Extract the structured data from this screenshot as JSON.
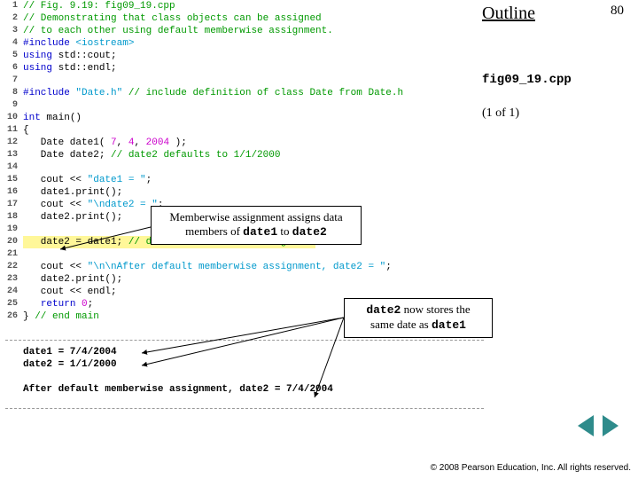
{
  "page_number": "80",
  "outline": "Outline",
  "filename": "fig09_19.cpp",
  "progress": "(1 of 1)",
  "lines": [
    {
      "n": "1",
      "seg": [
        {
          "t": "// Fig. 9.19: fig09_19.cpp",
          "c": "c-comment"
        }
      ]
    },
    {
      "n": "2",
      "seg": [
        {
          "t": "// Demonstrating that class objects can be assigned",
          "c": "c-comment"
        }
      ]
    },
    {
      "n": "3",
      "seg": [
        {
          "t": "// to each other using default memberwise assignment.",
          "c": "c-comment"
        }
      ]
    },
    {
      "n": "4",
      "seg": [
        {
          "t": "#include ",
          "c": "c-pre"
        },
        {
          "t": "<iostream>",
          "c": "c-str"
        }
      ]
    },
    {
      "n": "5",
      "seg": [
        {
          "t": "using",
          "c": "c-key"
        },
        {
          "t": " std::cout;",
          "c": ""
        }
      ]
    },
    {
      "n": "6",
      "seg": [
        {
          "t": "using",
          "c": "c-key"
        },
        {
          "t": " std::endl;",
          "c": ""
        }
      ]
    },
    {
      "n": "7",
      "seg": []
    },
    {
      "n": "8",
      "seg": [
        {
          "t": "#include ",
          "c": "c-pre"
        },
        {
          "t": "\"Date.h\"",
          "c": "c-str"
        },
        {
          "t": " // include definition of class Date from Date.h",
          "c": "c-comment"
        }
      ]
    },
    {
      "n": "9",
      "seg": []
    },
    {
      "n": "10",
      "seg": [
        {
          "t": "int",
          "c": "c-key"
        },
        {
          "t": " main()",
          "c": ""
        }
      ]
    },
    {
      "n": "11",
      "seg": [
        {
          "t": "{",
          "c": ""
        }
      ]
    },
    {
      "n": "12",
      "seg": [
        {
          "t": "   Date date1( ",
          "c": ""
        },
        {
          "t": "7",
          "c": "c-num"
        },
        {
          "t": ", ",
          "c": ""
        },
        {
          "t": "4",
          "c": "c-num"
        },
        {
          "t": ", ",
          "c": ""
        },
        {
          "t": "2004",
          "c": "c-num"
        },
        {
          "t": " );",
          "c": ""
        }
      ]
    },
    {
      "n": "13",
      "seg": [
        {
          "t": "   Date date2; ",
          "c": ""
        },
        {
          "t": "// date2 defaults to 1/1/2000",
          "c": "c-comment"
        }
      ]
    },
    {
      "n": "14",
      "seg": []
    },
    {
      "n": "15",
      "seg": [
        {
          "t": "   cout << ",
          "c": ""
        },
        {
          "t": "\"date1 = \"",
          "c": "c-str"
        },
        {
          "t": ";",
          "c": ""
        }
      ]
    },
    {
      "n": "16",
      "seg": [
        {
          "t": "   date1.print();",
          "c": ""
        }
      ]
    },
    {
      "n": "17",
      "seg": [
        {
          "t": "   cout << ",
          "c": ""
        },
        {
          "t": "\"\\ndate2 = \"",
          "c": "c-str"
        },
        {
          "t": ";",
          "c": ""
        }
      ]
    },
    {
      "n": "18",
      "seg": [
        {
          "t": "   date2.print();",
          "c": ""
        }
      ]
    },
    {
      "n": "19",
      "seg": []
    },
    {
      "n": "20",
      "hl": true,
      "seg": [
        {
          "t": "   date2 = date1; ",
          "c": ""
        },
        {
          "t": "// default memberwise assignment",
          "c": "c-comment"
        }
      ]
    },
    {
      "n": "21",
      "seg": []
    },
    {
      "n": "22",
      "seg": [
        {
          "t": "   cout << ",
          "c": ""
        },
        {
          "t": "\"\\n\\nAfter default memberwise assignment, date2 = \"",
          "c": "c-str"
        },
        {
          "t": ";",
          "c": ""
        }
      ]
    },
    {
      "n": "23",
      "seg": [
        {
          "t": "   date2.print();",
          "c": ""
        }
      ]
    },
    {
      "n": "24",
      "seg": [
        {
          "t": "   cout << endl;",
          "c": ""
        }
      ]
    },
    {
      "n": "25",
      "seg": [
        {
          "t": "   ",
          "c": ""
        },
        {
          "t": "return",
          "c": "c-key"
        },
        {
          "t": " ",
          "c": ""
        },
        {
          "t": "0",
          "c": "c-num"
        },
        {
          "t": ";",
          "c": ""
        }
      ]
    },
    {
      "n": "26",
      "seg": [
        {
          "t": "} ",
          "c": ""
        },
        {
          "t": "// end main",
          "c": "c-comment"
        }
      ]
    }
  ],
  "output": "date1 = 7/4/2004\ndate2 = 1/1/2000\n\nAfter default memberwise assignment, date2 = 7/4/2004",
  "callout1": {
    "pre": "Memberwise assignment assigns data",
    "mid": "members of ",
    "m1": "date1",
    "to": " to ",
    "m2": "date2"
  },
  "callout2": {
    "m1": "date2",
    "pre": " now stores the",
    "mid": "same date as ",
    "m2": "date1"
  },
  "copyright": "© 2008 Pearson Education, Inc.  All rights reserved."
}
